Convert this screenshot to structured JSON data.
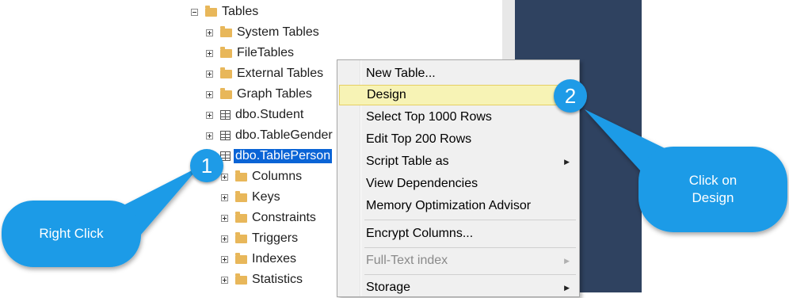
{
  "tree": {
    "tables": "Tables",
    "system_tables": "System Tables",
    "file_tables": "FileTables",
    "external_tables": "External Tables",
    "graph_tables": "Graph Tables",
    "student": "dbo.Student",
    "table_gender": "dbo.TableGender",
    "table_person": "dbo.TablePerson",
    "columns": "Columns",
    "keys": "Keys",
    "constraints": "Constraints",
    "triggers": "Triggers",
    "indexes": "Indexes",
    "statistics": "Statistics"
  },
  "context_menu": {
    "new_table": "New Table...",
    "design": "Design",
    "select_top": "Select Top 1000 Rows",
    "edit_top": "Edit Top 200 Rows",
    "script_table": "Script Table as",
    "view_dependencies": "View Dependencies",
    "memory_advisor": "Memory Optimization Advisor",
    "encrypt_columns": "Encrypt Columns...",
    "full_text_index": "Full-Text index",
    "storage": "Storage"
  },
  "callouts": {
    "step1_number": "1",
    "step1_text": "Right Click",
    "step2_number": "2",
    "step2_text_line1": "Click on",
    "step2_text_line2": "Design"
  },
  "colors": {
    "selection": "#0a64d6",
    "menu_highlight": "#f7f3b5",
    "callout": "#1e9be7",
    "dark_panel": "#2f4260"
  }
}
